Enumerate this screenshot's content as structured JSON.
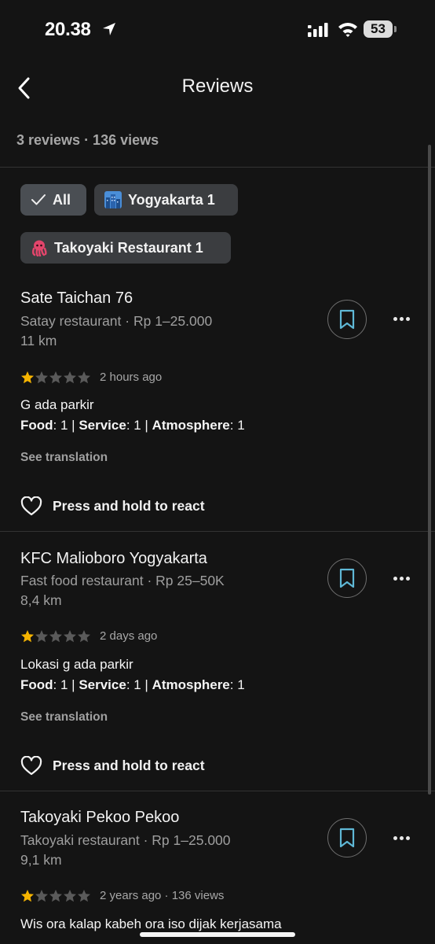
{
  "status": {
    "time": "20.38",
    "battery": "53"
  },
  "header": {
    "title": "Reviews"
  },
  "summary": "3 reviews · 136 views",
  "filters": [
    {
      "label": "All",
      "icon": "checkmark-icon",
      "selected": true
    },
    {
      "label": "Yogyakarta 1",
      "icon": "cityscape-emoji-icon",
      "selected": false
    },
    {
      "label": "Takoyaki Restaurant 1",
      "icon": "octopus-emoji-icon",
      "selected": false
    }
  ],
  "reviews": [
    {
      "name": "Sate Taichan 76",
      "meta": "Satay restaurant · Rp 1–25.000",
      "distance": "11 km",
      "rating": 1,
      "when": "2 hours ago",
      "text": "G ada parkir",
      "scores": {
        "food_label": "Food",
        "food": ": 1 | ",
        "service_label": "Service",
        "service": ": 1 | ",
        "atmosphere_label": "Atmosphere",
        "atmosphere": ": 1"
      },
      "see_translation": "See translation",
      "react": "Press and hold to react"
    },
    {
      "name": "KFC Malioboro Yogyakarta",
      "meta": "Fast food restaurant · Rp 25–50K",
      "distance": "8,4 km",
      "rating": 1,
      "when": "2 days ago",
      "text": "Lokasi g ada parkir",
      "scores": {
        "food_label": "Food",
        "food": ": 1 | ",
        "service_label": "Service",
        "service": ": 1 | ",
        "atmosphere_label": "Atmosphere",
        "atmosphere": ": 1"
      },
      "see_translation": "See translation",
      "react": "Press and hold to react"
    },
    {
      "name": "Takoyaki Pekoo Pekoo",
      "meta": "Takoyaki restaurant · Rp 1–25.000",
      "distance": "9,1 km",
      "rating": 1,
      "when": "2 years ago · 136 views",
      "text": "Wis ora kalap kabeh ora iso dijak kerjasama"
    }
  ],
  "colors": {
    "background": "#141414",
    "chip": "#3b3d40",
    "star_filled": "#f6b400",
    "star_empty": "#5a5a5a",
    "accent_bookmark": "#5fb8d6"
  }
}
